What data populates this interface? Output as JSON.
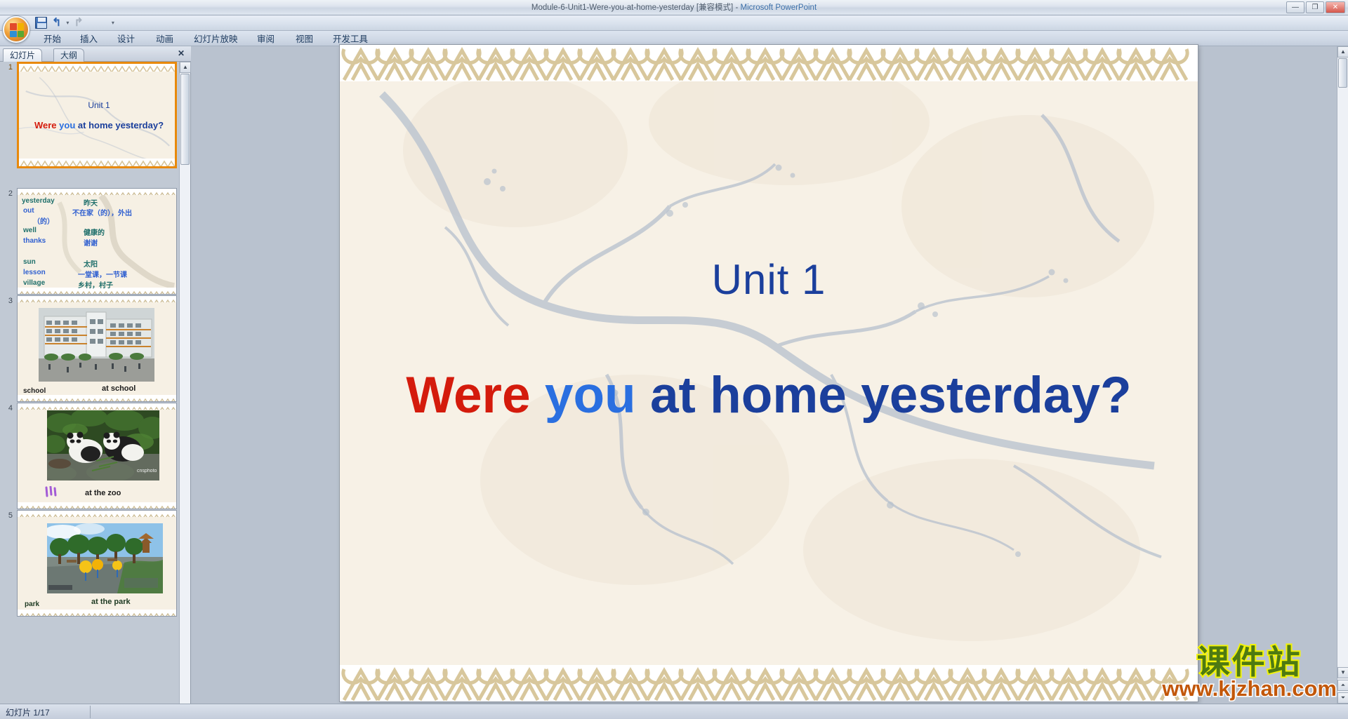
{
  "window": {
    "title": "Module-6-Unit1-Were-you-at-home-yesterday [兼容模式]",
    "separator": " - ",
    "app": "Microsoft PowerPoint",
    "minimize": "—",
    "maximize": "❐",
    "close": "✕"
  },
  "quick_access": {
    "save": "save-icon",
    "undo": "↰",
    "undo_arrow": "▾",
    "redo": "↱",
    "customize": "▾"
  },
  "ribbon_tabs": [
    {
      "label": "开始"
    },
    {
      "label": "插入"
    },
    {
      "label": "设计"
    },
    {
      "label": "动画"
    },
    {
      "label": "幻灯片放映"
    },
    {
      "label": "审阅"
    },
    {
      "label": "视图"
    },
    {
      "label": "开发工具"
    }
  ],
  "panel": {
    "tabs": [
      {
        "label": "幻灯片",
        "active": true
      },
      {
        "label": "大纲",
        "active": false
      }
    ],
    "close_label": "✕"
  },
  "slides": [
    {
      "number": "1",
      "selected": true,
      "kind": "title",
      "unit": "Unit 1",
      "question_parts": [
        {
          "text": "Were",
          "color": "red"
        },
        {
          "text": "you",
          "color": "blue"
        },
        {
          "text": "at home yesterday?",
          "color": "dark"
        }
      ]
    },
    {
      "number": "2",
      "selected": false,
      "kind": "vocab",
      "rows": [
        {
          "en": "yesterday",
          "cn": "昨天",
          "en_color": "teal",
          "cn_color": "teal"
        },
        {
          "en": "out",
          "cn": "不在家（的），外出",
          "en_color": "blue",
          "cn_color": "blue"
        },
        {
          "en": "",
          "cn": "（的）",
          "en_color": "blue",
          "cn_color": "blue"
        },
        {
          "en": "well",
          "cn": "健康的",
          "en_color": "teal",
          "cn_color": "teal"
        },
        {
          "en": "thanks",
          "cn": "谢谢",
          "en_color": "blue",
          "cn_color": "blue"
        },
        {
          "en": "sun",
          "cn": "太阳",
          "en_color": "teal",
          "cn_color": "teal"
        },
        {
          "en": "lesson",
          "cn": "一堂课，一节课",
          "en_color": "blue",
          "cn_color": "blue"
        },
        {
          "en": "village",
          "cn": "乡村，村子",
          "en_color": "teal",
          "cn_color": "teal"
        }
      ]
    },
    {
      "number": "3",
      "selected": false,
      "kind": "photo",
      "photo": "school-building-photo",
      "caption_left": "school",
      "caption_right": "at   school"
    },
    {
      "number": "4",
      "selected": false,
      "kind": "photo",
      "photo": "pandas-photo",
      "caption_left": "",
      "caption_right": "at the zoo"
    },
    {
      "number": "5",
      "selected": false,
      "kind": "photo",
      "photo": "park-photo",
      "caption_left": "park",
      "caption_right": "at the park"
    }
  ],
  "main_slide": {
    "unit": "Unit 1",
    "question_parts": [
      {
        "text": "Were",
        "color": "red"
      },
      {
        "text": "you",
        "color": "blue"
      },
      {
        "text": "at home yesterday?",
        "color": "dark"
      }
    ],
    "watermark_cn": "课件站",
    "watermark_url": "www.kjzhan.com"
  },
  "scrollbars": {
    "up": "▲",
    "down": "▼",
    "prev_slide": "⏶",
    "next_slide": "⏷"
  },
  "statusbar": {
    "slide_counter": "幻灯片 1/17"
  },
  "colors": {
    "accent_orange": "#e8890b",
    "title_blue": "#1b3f9c",
    "word_red": "#d41b0c",
    "word_blue": "#2a6fe0",
    "slide_bg": "#f7f1e6",
    "border_tan": "#d8c79c",
    "workarea": "#b9c2cf"
  }
}
